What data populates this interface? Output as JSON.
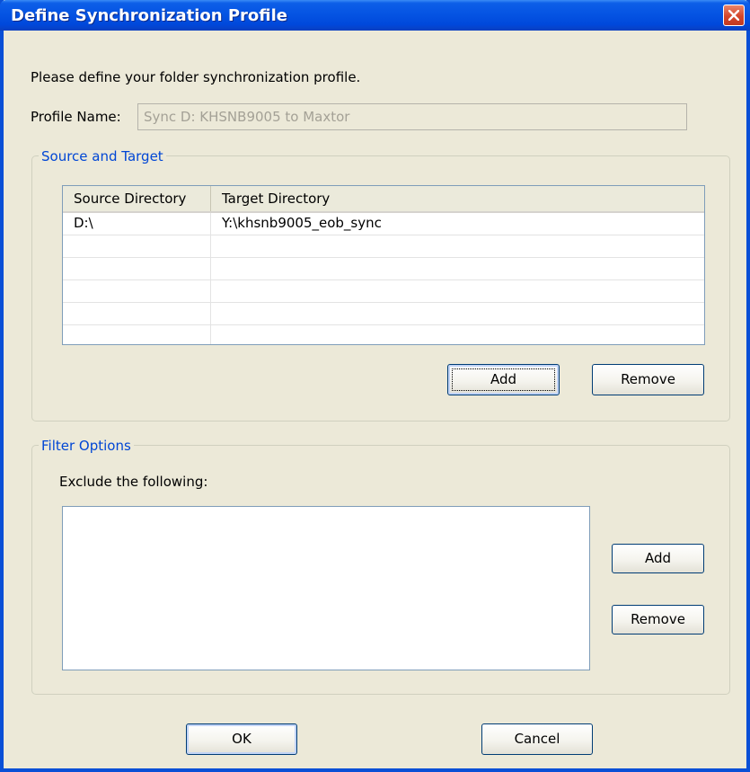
{
  "window": {
    "title": "Define Synchronization Profile"
  },
  "intro": "Please define your folder synchronization profile.",
  "profile": {
    "label": "Profile Name:",
    "value": "Sync D: KHSNB9005 to Maxtor"
  },
  "source_target": {
    "group_label": "Source and Target",
    "columns": [
      "Source Directory",
      "Target Directory"
    ],
    "rows": [
      [
        "D:\\",
        "Y:\\khsnb9005_eob_sync"
      ],
      [
        "",
        ""
      ],
      [
        "",
        ""
      ],
      [
        "",
        ""
      ],
      [
        "",
        ""
      ],
      [
        "",
        ""
      ]
    ],
    "add_label": "Add",
    "remove_label": "Remove"
  },
  "filter": {
    "group_label": "Filter Options",
    "exclude_label": "Exclude the following:",
    "add_label": "Add",
    "remove_label": "Remove"
  },
  "footer": {
    "ok_label": "OK",
    "cancel_label": "Cancel"
  },
  "colors": {
    "titlebar": "#0554e3",
    "group_label": "#0046d5",
    "dialog_bg": "#ece9d8"
  }
}
